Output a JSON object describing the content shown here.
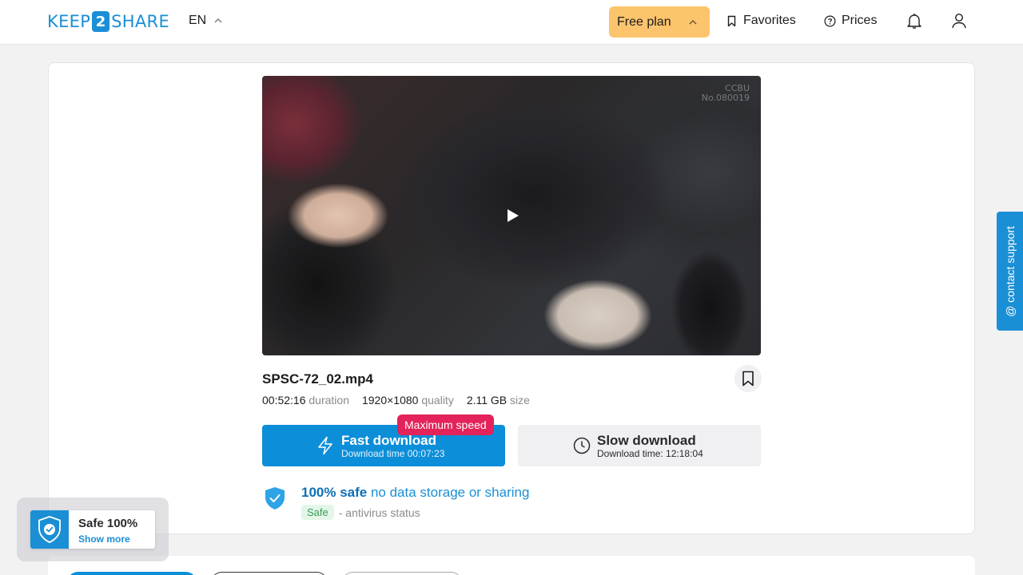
{
  "header": {
    "logo": {
      "left": "KEEP",
      "mid": "2",
      "right": "SHARE"
    },
    "language": "EN",
    "plan_label": "Free plan",
    "favorites_label": "Favorites",
    "prices_label": "Prices"
  },
  "video": {
    "watermark_line1": "CCBU",
    "watermark_line2": "No.080019"
  },
  "file": {
    "name": "SPSC-72_02.mp4",
    "duration_value": "00:52:16",
    "duration_label": "duration",
    "quality_value": "1920×1080",
    "quality_label": "quality",
    "size_value": "2.11 GB",
    "size_label": "size"
  },
  "download": {
    "badge": "Maximum speed",
    "fast_title": "Fast download",
    "fast_sub": "Download time 00:07:23",
    "slow_title": "Slow download",
    "slow_sub": "Download time: 12:18:04"
  },
  "safety": {
    "headline_strong": "100% safe",
    "headline_rest": "no data storage or sharing",
    "av_badge": "Safe",
    "av_text": "- antivirus status"
  },
  "support_label": "@ contact support",
  "safe_widget": {
    "title": "Safe 100%",
    "link": "Show more"
  },
  "colors": {
    "accent": "#0d8ed9",
    "plan": "#fcc46c",
    "badge": "#e3235a"
  }
}
